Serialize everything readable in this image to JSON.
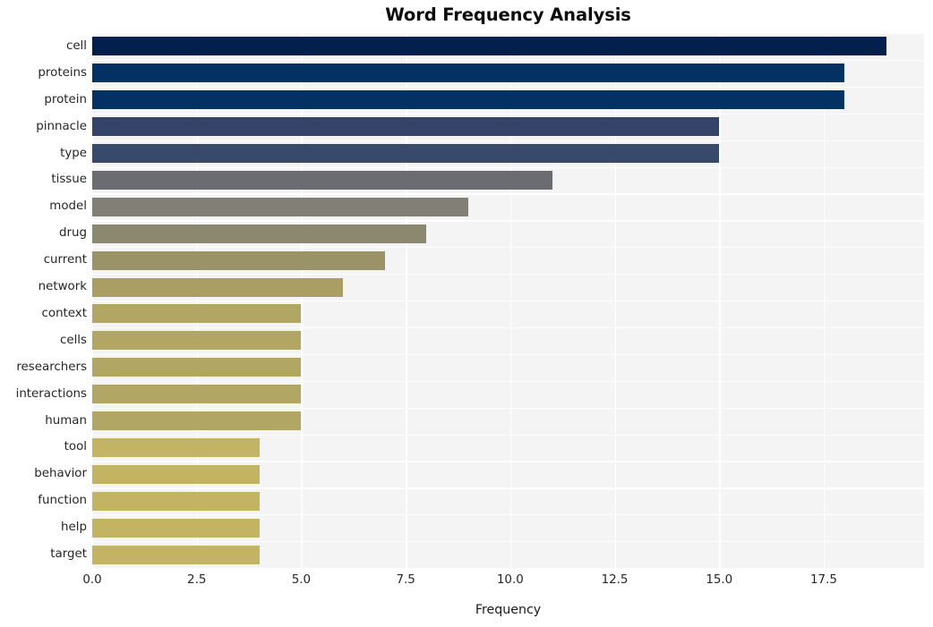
{
  "chart_data": {
    "type": "bar",
    "orientation": "horizontal",
    "title": "Word Frequency Analysis",
    "xlabel": "Frequency",
    "ylabel": "",
    "xlim": [
      0,
      19.9
    ],
    "ylim": [
      0,
      20
    ],
    "grid": true,
    "legend": false,
    "xticks": [
      "0.0",
      "2.5",
      "5.0",
      "7.5",
      "10.0",
      "12.5",
      "15.0",
      "17.5"
    ],
    "xtick_values": [
      0.0,
      2.5,
      5.0,
      7.5,
      10.0,
      12.5,
      15.0,
      17.5
    ],
    "categories": [
      "cell",
      "proteins",
      "protein",
      "pinnacle",
      "type",
      "tissue",
      "model",
      "drug",
      "current",
      "network",
      "context",
      "cells",
      "researchers",
      "interactions",
      "human",
      "tool",
      "behavior",
      "function",
      "help",
      "target"
    ],
    "values": [
      19,
      18,
      18,
      15,
      15,
      11,
      9,
      8,
      7,
      6,
      5,
      5,
      5,
      5,
      5,
      4,
      4,
      4,
      4,
      4
    ],
    "bar_colors": [
      "#03204c",
      "#033163",
      "#033163",
      "#344469",
      "#374a6b",
      "#6b6b72",
      "#827f76",
      "#8c876f",
      "#9b9368",
      "#a99f64",
      "#b1a664",
      "#b1a664",
      "#b1a664",
      "#b1a664",
      "#b1a664",
      "#c2b463",
      "#c2b463",
      "#c2b463",
      "#c2b463",
      "#c2b463"
    ],
    "plot_background": "#f4f4f5",
    "grid_color": "#ffffff",
    "figure_background": "#ffffff"
  }
}
